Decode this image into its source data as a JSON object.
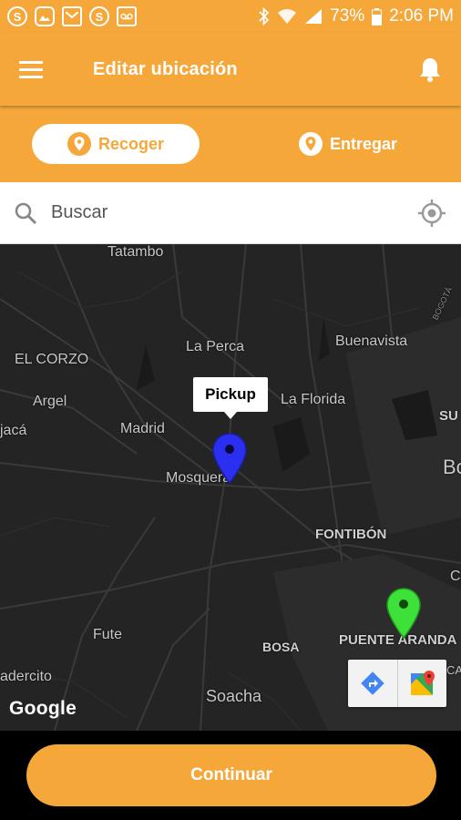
{
  "status_bar": {
    "battery": "73%",
    "time": "2:06 PM",
    "left_icons": [
      "skype-icon",
      "image-icon",
      "mail-icon",
      "skype-icon",
      "voicemail-icon"
    ]
  },
  "app_bar": {
    "title": "Editar ubicación"
  },
  "toggle": {
    "pickup_label": "Recoger",
    "deliver_label": "Entregar"
  },
  "search": {
    "placeholder": "Buscar",
    "value": ""
  },
  "map": {
    "places": {
      "tatambo": "Tatambo",
      "la_perca": "La Perca",
      "buenavista": "Buenavista",
      "el_corzo": "EL CORZO",
      "argel": "Argel",
      "la_florida": "La Florida",
      "jaca": "jacá",
      "madrid": "Madrid",
      "su": "SU",
      "bo": "Bo",
      "mosquera": "Mosquera",
      "fontibon": "FONTIBÓN",
      "c": "C",
      "fute": "Fute",
      "bosa": "BOSA",
      "puente_aranda": "PUENTE ARANDA",
      "ca": "CA",
      "adercito": "adercito",
      "soacha": "Soacha",
      "bogota_road": "BOGOTÁ"
    },
    "pickup_marker_label": "Pickup",
    "pickup_color": "#2a2ff0",
    "dropoff_color": "#3ee13a",
    "attribution": "Google"
  },
  "footer": {
    "continue_label": "Continuar"
  },
  "colors": {
    "accent": "#f5a73a",
    "map_bg": "#242424"
  }
}
